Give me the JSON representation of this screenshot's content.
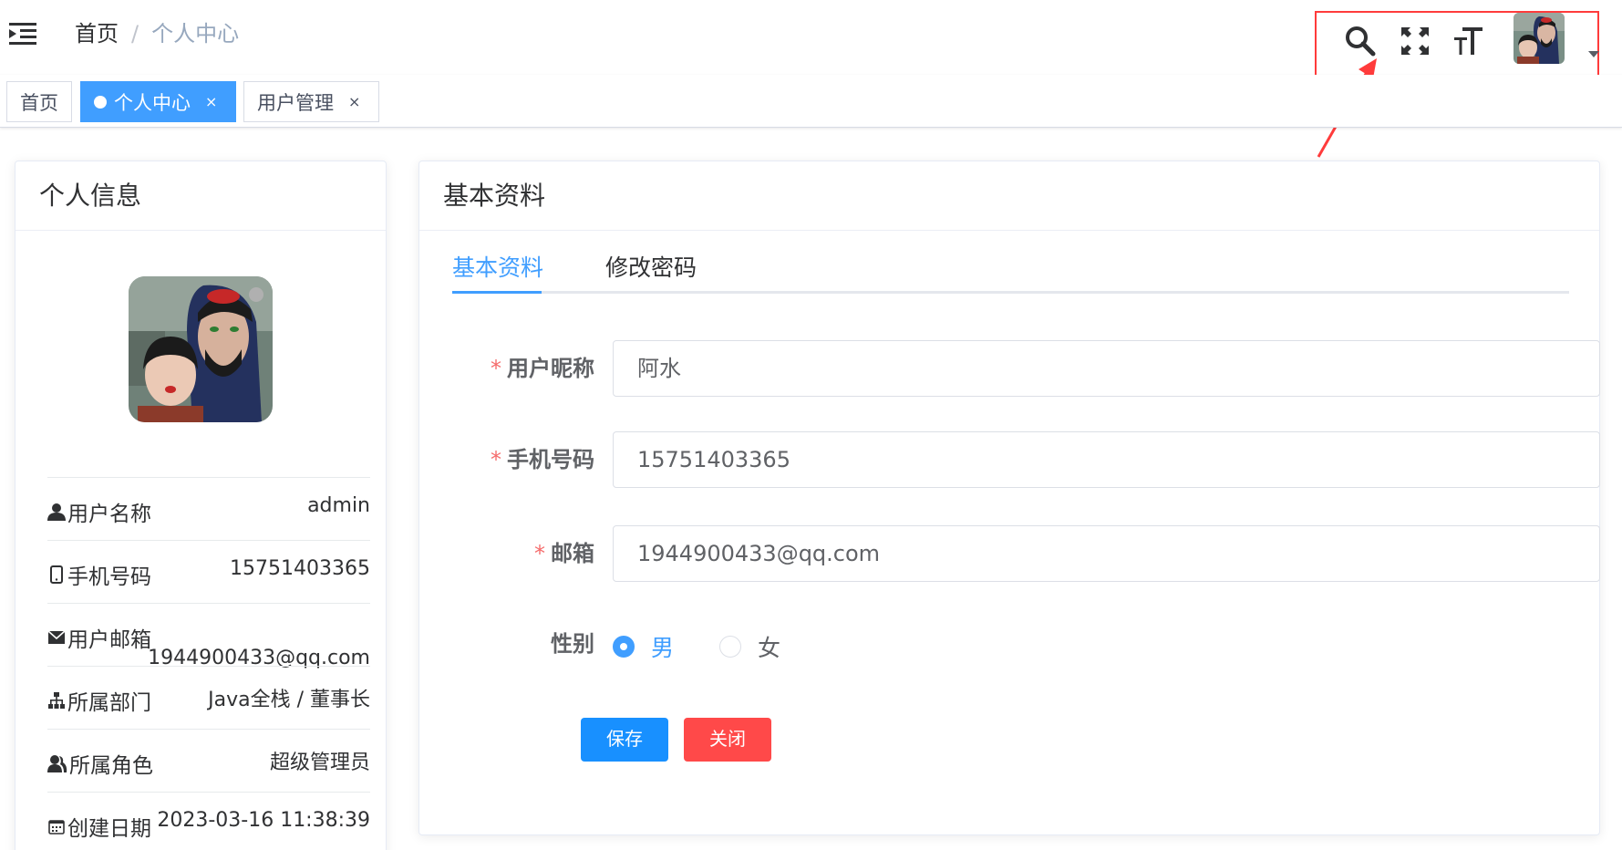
{
  "navbar": {
    "breadcrumb": {
      "home": "首页",
      "separator": "/",
      "current": "个人中心"
    },
    "icons": [
      "menu-toggle-icon",
      "search-icon",
      "fullscreen-icon",
      "font-size-icon",
      "caret-down-icon"
    ],
    "highlight_color": "#ff3b3b"
  },
  "tags": [
    {
      "label": "首页"
    },
    {
      "label": "个人中心",
      "close": "×",
      "active": true
    },
    {
      "label": "用户管理",
      "close": "×"
    }
  ],
  "profile_card": {
    "title": "个人信息",
    "rows": [
      {
        "label": "用户名称",
        "value": "admin",
        "icon": "user-icon"
      },
      {
        "label": "手机号码",
        "value": "15751403365",
        "icon": "phone-icon"
      },
      {
        "label": "用户邮箱",
        "value": "1944900433@qq.com",
        "icon": "mail-icon"
      },
      {
        "label": "所属部门",
        "value": "Java全栈 / 董事长",
        "icon": "tree-icon"
      },
      {
        "label": "所属角色",
        "value": "超级管理员",
        "icon": "peoples-icon"
      },
      {
        "label": "创建日期",
        "value": "2023-03-16 11:38:39",
        "icon": "date-icon"
      }
    ]
  },
  "basic_card": {
    "title": "基本资料",
    "tabs": [
      "基本资料",
      "修改密码"
    ],
    "form": {
      "nickname": {
        "label": "用户昵称",
        "value": "阿水"
      },
      "phone": {
        "label": "手机号码",
        "value": "15751403365"
      },
      "email": {
        "label": "邮箱",
        "value": "1944900433@qq.com"
      },
      "gender": {
        "label": "性别",
        "options": [
          "男",
          "女"
        ],
        "selected": "男"
      },
      "required_mark": "*"
    },
    "buttons": {
      "save": "保存",
      "close": "关闭"
    }
  },
  "colors": {
    "primary": "#409eff",
    "danger": "#ff4949",
    "tag_active": "#409eff"
  }
}
